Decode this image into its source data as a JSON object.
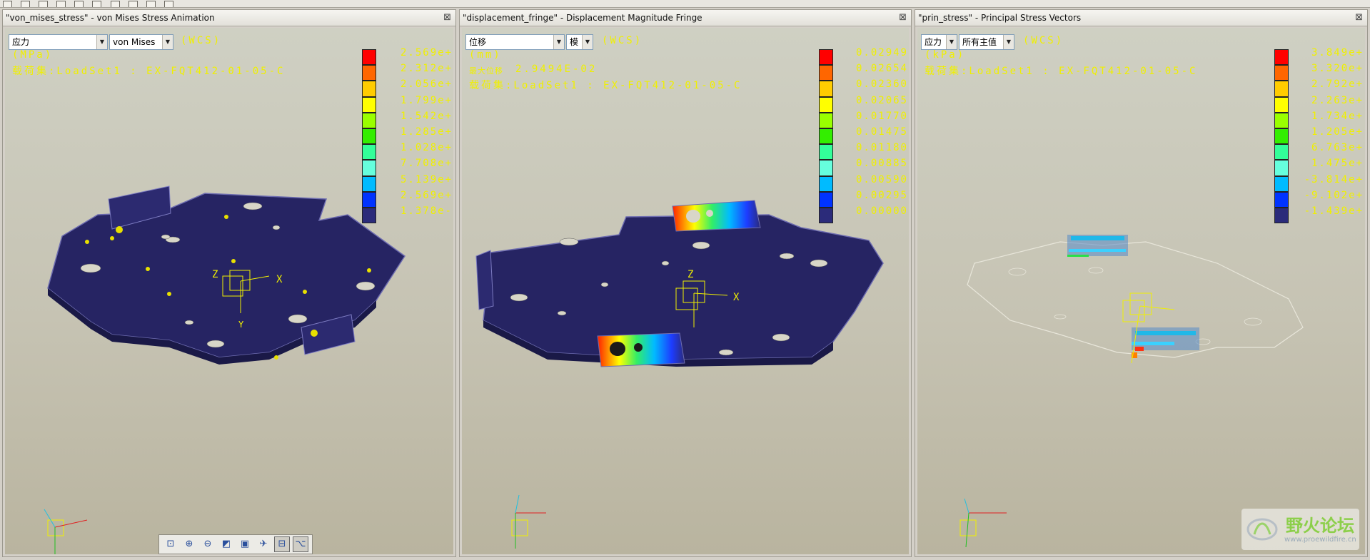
{
  "panels": [
    {
      "title": "\"von_mises_stress\" - von Mises Stress Animation",
      "close": "⊠",
      "controls": [
        "应力",
        "von Mises"
      ],
      "wcs": "(WCS)",
      "unit": "(MPa)",
      "loadset_label": "载荷集:LoadSet1 :  EX-FQT412-01-05-C",
      "legend_values": [
        "2.569e+",
        "2.312e+",
        "2.056e+",
        "1.799e+",
        "1.542e+",
        "1.285e+",
        "1.028e+",
        "7.708e+",
        "5.139e+",
        "2.569e+",
        "1.378e-"
      ]
    },
    {
      "title": "\"displacement_fringe\" - Displacement Magnitude Fringe",
      "close": "⊠",
      "controls": [
        "位移",
        "模"
      ],
      "wcs": "(WCS)",
      "unit": "(mm)",
      "maxdisp_label": "最大位移",
      "maxdisp_value": "2.9494E-02",
      "loadset_label": "载荷集:LoadSet1 :  EX-FQT412-01-05-C",
      "legend_values": [
        "0.02949",
        "0.02654",
        "0.02360",
        "0.02065",
        "0.01770",
        "0.01475",
        "0.01180",
        "0.00885",
        "0.00590",
        "0.00295",
        "0.00000"
      ]
    },
    {
      "title": "\"prin_stress\" - Principal Stress Vectors",
      "close": "⊠",
      "controls": [
        "应力",
        "所有主值"
      ],
      "wcs": "(WCS)",
      "unit": "(kPa)",
      "loadset_label": "载荷集:LoadSet1 :  EX-FQT412-01-05-C",
      "legend_values": [
        "3.849e+",
        "3.320e+",
        "2.792e+",
        "2.263e+",
        "1.734e+",
        "1.205e+",
        "6.763e+",
        "1.475e+",
        "-3.814e+",
        "-9.102e+",
        "-1.439e+"
      ]
    }
  ],
  "legend_colors": [
    "#ff0000",
    "#ff6600",
    "#ffcc00",
    "#ffff00",
    "#99ff00",
    "#33ee00",
    "#33ff99",
    "#66ffdd",
    "#00bbff",
    "#0033ff",
    "#2b2b7a"
  ],
  "axis_labels": {
    "x": "X",
    "y": "Y",
    "z": "Z"
  },
  "watermark": {
    "title": "野火论坛",
    "url": "www.proewildfire.cn"
  }
}
